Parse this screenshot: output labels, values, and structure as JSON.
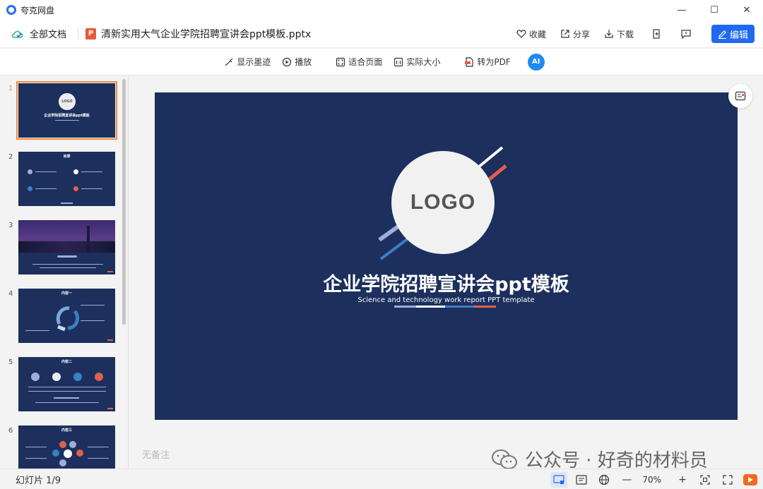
{
  "app": {
    "title": "夸克网盘"
  },
  "window": {
    "minimize": "—",
    "maximize": "☐",
    "close": "✕"
  },
  "header": {
    "all_docs": "全部文档",
    "file_name": "清新实用大气企业学院招聘宣讲会ppt模板.pptx",
    "file_icon_letter": "P",
    "collect": "收藏",
    "share": "分享",
    "download": "下载",
    "edit": "编辑"
  },
  "toolbar": {
    "show_ink": "显示墨迹",
    "play": "播放",
    "fit_page": "适合页面",
    "actual_size": "实际大小",
    "to_pdf": "转为PDF",
    "ai_label": "AI"
  },
  "thumbnails": [
    {
      "num": "1",
      "title": "企业学院招聘宣讲会ppt模板",
      "logo": "LOGO"
    },
    {
      "num": "2",
      "title": "目录"
    },
    {
      "num": "3",
      "title": ""
    },
    {
      "num": "4",
      "title": "内容一"
    },
    {
      "num": "5",
      "title": "内容二"
    },
    {
      "num": "6",
      "title": "内容三"
    }
  ],
  "slide": {
    "logo": "LOGO",
    "title": "企业学院招聘宣讲会ppt模板",
    "subtitle": "Science and technology work report PPT template"
  },
  "notes_placeholder": "无备注",
  "watermark": "公众号 · 好奇的材料员",
  "status": {
    "slide_count": "幻灯片 1/9",
    "zoom_out": "—",
    "zoom": "70%",
    "zoom_in": "+"
  },
  "colors": {
    "slide_bg": "#1c2f5d",
    "accent_blue": "#1f6af0",
    "accent_orange": "#f08a3c",
    "accent_red": "#e0604a"
  }
}
